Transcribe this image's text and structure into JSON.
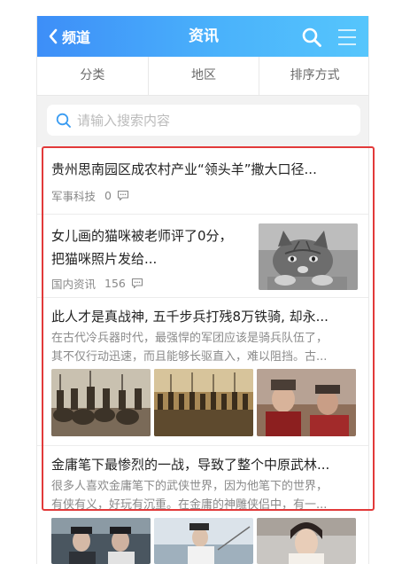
{
  "header": {
    "back_label": "频道",
    "title": "资讯"
  },
  "filters": [
    "分类",
    "地区",
    "排序方式"
  ],
  "search": {
    "placeholder": "请输入搜索内容"
  },
  "articles": [
    {
      "title": "贵州思南园区成农村产业“领头羊”撒大口径...",
      "source": "军事科技",
      "comments": "0"
    },
    {
      "title_line1": "女儿画的猫咪被老师评了0分，",
      "title_line2": "把猫咪照片发给...",
      "source": "国内资讯",
      "comments": "156"
    },
    {
      "title": "此人才是真战神, 五千步兵打残8万铁骑, 却永...",
      "summary_line1": "在古代冷兵器时代，最强悍的军团应该是骑兵队伍了，",
      "summary_line2": "其不仅行动迅速，而且能够长驱直入，难以阻挡。古..."
    },
    {
      "title": "金庸笔下最惨烈的一战，导致了整个中原武林...",
      "summary_line1": "很多人喜欢金庸笔下的武侠世界，因为他笔下的世界，",
      "summary_line2": "有侠有义，好玩有沉重。在金庸的神雕侠侣中，有一..."
    }
  ],
  "colors": {
    "header_start": "#3d8ef8",
    "header_end": "#56c6fc",
    "highlight_frame": "#e23a3a",
    "search_icon": "#3a9cf2"
  }
}
